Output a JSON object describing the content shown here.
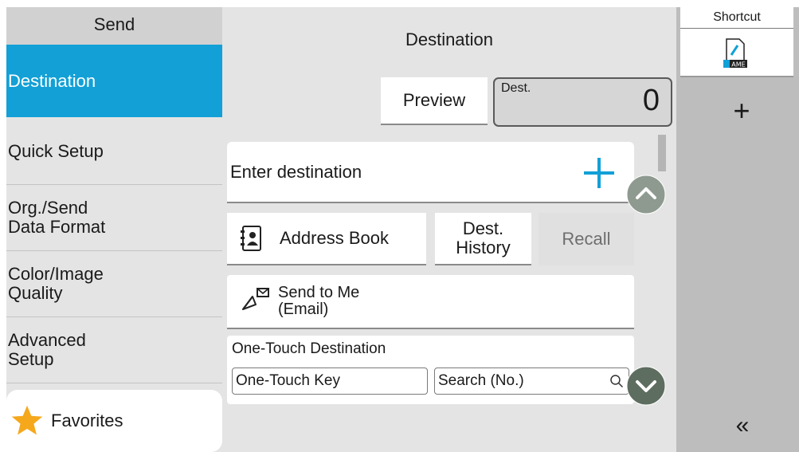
{
  "sidebar": {
    "title": "Send",
    "items": [
      {
        "lines": [
          "Destination"
        ],
        "active": true
      },
      {
        "lines": [
          "Quick Setup"
        ]
      },
      {
        "lines": [
          "Org./Send",
          "Data Format"
        ]
      },
      {
        "lines": [
          "Color/Image",
          "Quality"
        ]
      },
      {
        "lines": [
          "Advanced",
          "Setup"
        ]
      }
    ],
    "favorites_label": "Favorites",
    "favorites_icon": "star-icon"
  },
  "main": {
    "title": "Destination",
    "preview_label": "Preview",
    "dest_label": "Dest.",
    "dest_count": "0",
    "enter_destination_label": "Enter destination",
    "address_book_label": "Address Book",
    "dest_history_lines": [
      "Dest.",
      "History"
    ],
    "recall_label": "Recall",
    "send_to_me_lines": [
      "Send to Me",
      "(Email)"
    ],
    "one_touch_title": "One-Touch Destination",
    "one_touch_key_label": "One-Touch Key",
    "search_no_label": "Search (No.)"
  },
  "shortcut": {
    "title": "Shortcut",
    "icon_text": "AME",
    "add_label": "+",
    "collapse_label": "«"
  },
  "colors": {
    "accent": "#12a0d6",
    "sidebar_bg": "#e4e4e4",
    "shortcut_bg": "#bdbdbd",
    "star": "#f5a81c",
    "scroll_button": "#5d6d5f"
  }
}
